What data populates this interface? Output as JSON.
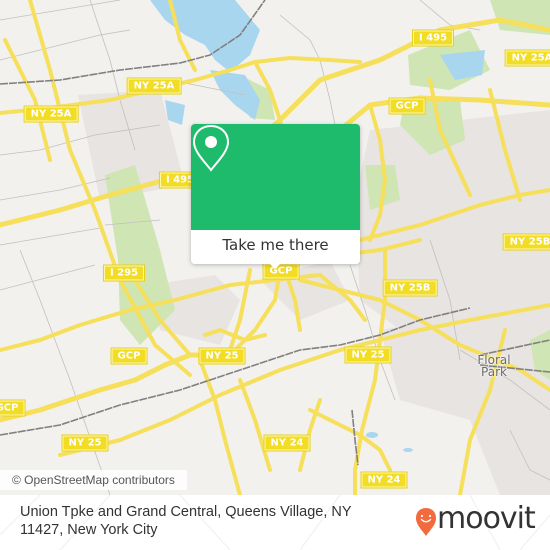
{
  "map": {
    "colors": {
      "background": "#f2f1ee",
      "urban": "#e8e4e1",
      "park": "#cfe5b4",
      "water": "#a8d6ee",
      "major_road": "#f6df5a",
      "minor_road": "#b8b6b2",
      "rail": "#808080"
    },
    "shields": [
      {
        "label": "I 495",
        "id": "i495-north"
      },
      {
        "label": "NY 25A",
        "id": "ny25a-top-right"
      },
      {
        "label": "NY 25A",
        "id": "ny25a-center"
      },
      {
        "label": "NY 25A",
        "id": "ny25a-left"
      },
      {
        "label": "I 495",
        "id": "i495-west"
      },
      {
        "label": "GCP",
        "id": "gcp-north"
      },
      {
        "label": "NY 25B",
        "id": "ny25b-right"
      },
      {
        "label": "I 295",
        "id": "i295"
      },
      {
        "label": "GCP",
        "id": "gcp-center"
      },
      {
        "label": "NY 25B",
        "id": "ny25b-center"
      },
      {
        "label": "GCP",
        "id": "gcp-west"
      },
      {
        "label": "NY 25",
        "id": "ny25-center-west"
      },
      {
        "label": "NY 25",
        "id": "ny25-center"
      },
      {
        "label": "GCP",
        "id": "gcp-far-west"
      },
      {
        "label": "NY 25",
        "id": "ny25-west"
      },
      {
        "label": "NY 24",
        "id": "ny24-center"
      },
      {
        "label": "NY 24",
        "id": "ny24-east"
      }
    ],
    "place_labels": [
      {
        "line1": "Floral",
        "line2": "Park"
      }
    ],
    "attribution": "© OpenStreetMap contributors"
  },
  "popup": {
    "icon": "map-pin-icon",
    "button_label": "Take me there",
    "accent": "#1fbb6c"
  },
  "footer": {
    "address": "Union Tpke and Grand Central, Queens Village, NY 11427, New York City",
    "brand": "moovit",
    "brand_icon": "moovit-pin-smile-icon",
    "brand_color": "#f26a3d"
  }
}
